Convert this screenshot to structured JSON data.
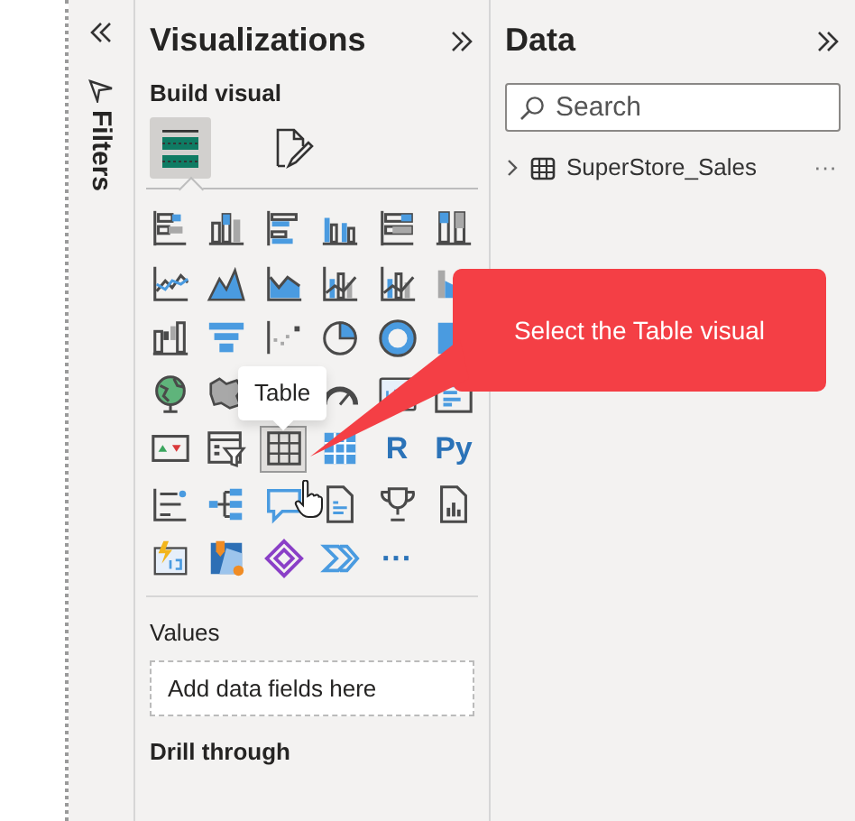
{
  "filters_pane": {
    "title": "Filters"
  },
  "visualizations": {
    "title": "Visualizations",
    "section": "Build visual",
    "modes": [
      {
        "kind": "fields",
        "selected": true
      },
      {
        "kind": "format",
        "selected": false
      }
    ],
    "visuals": [
      {
        "kind": "stacked-bar",
        "selected": false
      },
      {
        "kind": "stacked-column",
        "selected": false
      },
      {
        "kind": "clustered-bar",
        "selected": false
      },
      {
        "kind": "clustered-column",
        "selected": false
      },
      {
        "kind": "full-bar",
        "selected": false
      },
      {
        "kind": "full-column",
        "selected": false
      },
      {
        "kind": "line",
        "selected": false
      },
      {
        "kind": "area",
        "selected": false
      },
      {
        "kind": "stacked-area",
        "selected": false
      },
      {
        "kind": "line-column",
        "selected": false
      },
      {
        "kind": "line-column",
        "selected": false
      },
      {
        "kind": "ribbon",
        "selected": false
      },
      {
        "kind": "waterfall",
        "selected": false
      },
      {
        "kind": "funnel",
        "selected": false
      },
      {
        "kind": "scatter",
        "selected": false
      },
      {
        "kind": "pie",
        "selected": false
      },
      {
        "kind": "donut",
        "selected": false
      },
      {
        "kind": "treemap",
        "selected": false
      },
      {
        "kind": "globe",
        "selected": false
      },
      {
        "kind": "filled-map",
        "selected": false
      },
      {
        "kind": "hidden"
      },
      {
        "kind": "gauge",
        "selected": false
      },
      {
        "kind": "card",
        "selected": false
      },
      {
        "kind": "multi-card",
        "selected": false
      },
      {
        "kind": "kpi",
        "selected": false
      },
      {
        "kind": "slicer",
        "selected": false
      },
      {
        "kind": "table",
        "selected": true
      },
      {
        "kind": "matrix",
        "selected": false
      },
      {
        "kind": "text",
        "label": "R",
        "selected": false
      },
      {
        "kind": "text",
        "label": "Py",
        "selected": false
      },
      {
        "kind": "decomposition",
        "selected": false
      },
      {
        "kind": "hierarchy",
        "selected": false
      },
      {
        "kind": "speech",
        "selected": false
      },
      {
        "kind": "document",
        "selected": false
      },
      {
        "kind": "trophy",
        "selected": false
      },
      {
        "kind": "report",
        "selected": false
      },
      {
        "kind": "lightning-card",
        "selected": false
      },
      {
        "kind": "azure-map",
        "selected": false
      },
      {
        "kind": "diamond",
        "selected": false
      },
      {
        "kind": "chevrons",
        "selected": false
      },
      {
        "kind": "text",
        "label": "···",
        "selected": false
      }
    ],
    "tooltip": "Table",
    "values": {
      "label": "Values",
      "placeholder": "Add data fields here"
    },
    "drill_through": {
      "title": "Drill through"
    }
  },
  "data_pane": {
    "title": "Data",
    "search": {
      "placeholder": "Search"
    },
    "tables": [
      {
        "name": "SuperStore_Sales",
        "expanded": false,
        "menu": "···"
      }
    ]
  },
  "callout": {
    "text": "Select the Table visual"
  }
}
